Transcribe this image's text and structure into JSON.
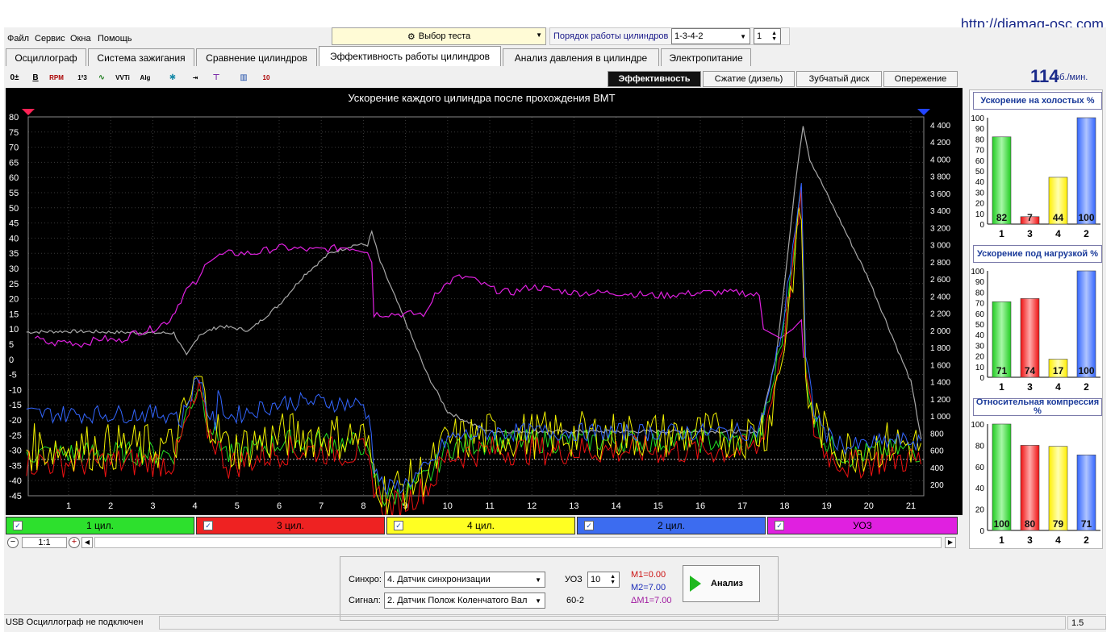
{
  "url": "http://diamag-osc.com",
  "menu": [
    "Файл",
    "Сервис",
    "Окна",
    "Помощь"
  ],
  "test_select": "Выбор теста",
  "firing_order": {
    "label": "Порядок работы цилиндров",
    "value": "1-3-4-2",
    "count": "1"
  },
  "tabs": [
    "Осциллограф",
    "Система зажигания",
    "Сравнение цилиндров",
    "Эффективность работы цилиндров",
    "Анализ давления в цилиндре",
    "Электропитание"
  ],
  "active_tab": "Эффективность работы цилиндров",
  "subtabs": [
    "Эффективность",
    "Сжатие (дизель)",
    "Зубчатый диск",
    "Опережение"
  ],
  "rpm": {
    "value": "114",
    "unit": "об./мин."
  },
  "toolbar_icons": [
    "zero-offset-icon",
    "bold-icon",
    "rpm-icon",
    "order-icon",
    "trace-icon",
    "vvti-icon",
    "alg-icon",
    "engine-icon",
    "cursor-icon",
    "marker-icon",
    "bars-icon",
    "scale-icon"
  ],
  "chart_data": {
    "type": "line",
    "title": "Ускорение каждого цилиндра после прохождения ВМТ",
    "y_left_ticks": [
      "80",
      "75",
      "70",
      "65",
      "60",
      "55",
      "50",
      "45",
      "40",
      "35",
      "30",
      "25",
      "20",
      "15",
      "10",
      "5",
      "0",
      "-5",
      "-10",
      "-15",
      "-20",
      "-25",
      "-30",
      "-35",
      "-40",
      "-45"
    ],
    "y_right_ticks": [
      "4 400",
      "4 200",
      "4 000",
      "3 800",
      "3 600",
      "3 400",
      "3 200",
      "3 000",
      "2 800",
      "2 600",
      "2 400",
      "2 200",
      "2 000",
      "1 800",
      "1 600",
      "1 400",
      "1 200",
      "1 000",
      "800",
      "600",
      "400",
      "200"
    ],
    "x_ticks": [
      "1",
      "2",
      "3",
      "4",
      "5",
      "6",
      "7",
      "8",
      "9",
      "10",
      "11",
      "12",
      "13",
      "14",
      "15",
      "16",
      "17",
      "18",
      "19",
      "20",
      "21"
    ],
    "series": [
      {
        "name": "1 цил.",
        "color": "#22dd22"
      },
      {
        "name": "3 цил.",
        "color": "#ee1111"
      },
      {
        "name": "4 цил.",
        "color": "#f0f000"
      },
      {
        "name": "2 цил.",
        "color": "#3366ff"
      },
      {
        "name": "УОЗ",
        "color": "#dd22dd"
      }
    ]
  },
  "legend": [
    {
      "label": "1 цил.",
      "color": "#2de02d"
    },
    {
      "label": "3 цил.",
      "color": "#ee2222"
    },
    {
      "label": "4 цил.",
      "color": "#ffff22"
    },
    {
      "label": "2 цил.",
      "color": "#3c6cf0"
    },
    {
      "label": "УОЗ",
      "color": "#e020e0"
    }
  ],
  "zoom_label": "1:1",
  "side_charts": [
    {
      "title": "Ускорение на холостых %",
      "ticks": [
        "100",
        "90",
        "80",
        "70",
        "60",
        "50",
        "40",
        "30",
        "20",
        "10",
        "0"
      ],
      "cats": [
        "1",
        "3",
        "4",
        "2"
      ],
      "values": [
        82,
        7,
        44,
        100
      ]
    },
    {
      "title": "Ускорение под нагрузкой %",
      "ticks": [
        "100",
        "90",
        "80",
        "70",
        "60",
        "50",
        "40",
        "30",
        "20",
        "10",
        "0"
      ],
      "cats": [
        "1",
        "3",
        "4",
        "2"
      ],
      "values": [
        71,
        74,
        17,
        100
      ]
    },
    {
      "title": "Относительная компрессия %",
      "ticks": [
        "100",
        "80",
        "60",
        "40",
        "20",
        "0"
      ],
      "cats": [
        "1",
        "3",
        "4",
        "2"
      ],
      "values": [
        100,
        80,
        79,
        71
      ]
    }
  ],
  "bottom": {
    "sync_label": "Синхро:",
    "sync_value": "4. Датчик синхронизации",
    "signal_label": "Сигнал:",
    "signal_value": "2. Датчик Полож Коленчатого Вал",
    "uoz_label": "УОЗ",
    "uoz_value": "10",
    "teeth": "60-2",
    "m1": "M1=0.00",
    "m2": "M2=7.00",
    "dm": "ΔM1=7.00",
    "analyze": "Анализ"
  },
  "status": {
    "left": "USB Осциллограф не подключен",
    "right": "1.5"
  }
}
